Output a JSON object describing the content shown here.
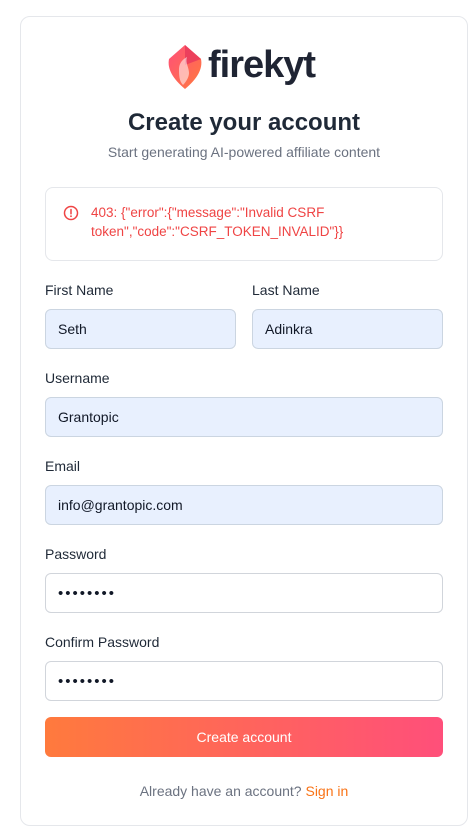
{
  "brand": {
    "name": "firekyt",
    "accent": "#f97316"
  },
  "header": {
    "title": "Create your account",
    "subtitle": "Start generating AI-powered affiliate content"
  },
  "alert": {
    "icon": "alert-circle-icon",
    "message": "403: {\"error\":{\"message\":\"Invalid CSRF token\",\"code\":\"CSRF_TOKEN_INVALID\"}}",
    "color": "#ef4444"
  },
  "form": {
    "first_name": {
      "label": "First Name",
      "value": "Seth"
    },
    "last_name": {
      "label": "Last Name",
      "value": "Adinkra"
    },
    "username": {
      "label": "Username",
      "value": "Grantopic"
    },
    "email": {
      "label": "Email",
      "value": "info@grantopic.com"
    },
    "password": {
      "label": "Password",
      "value": "secret12"
    },
    "confirm_password": {
      "label": "Confirm Password",
      "value": "secret12"
    },
    "submit_label": "Create account"
  },
  "footer": {
    "prompt": "Already have an account?",
    "link_label": "Sign in"
  }
}
